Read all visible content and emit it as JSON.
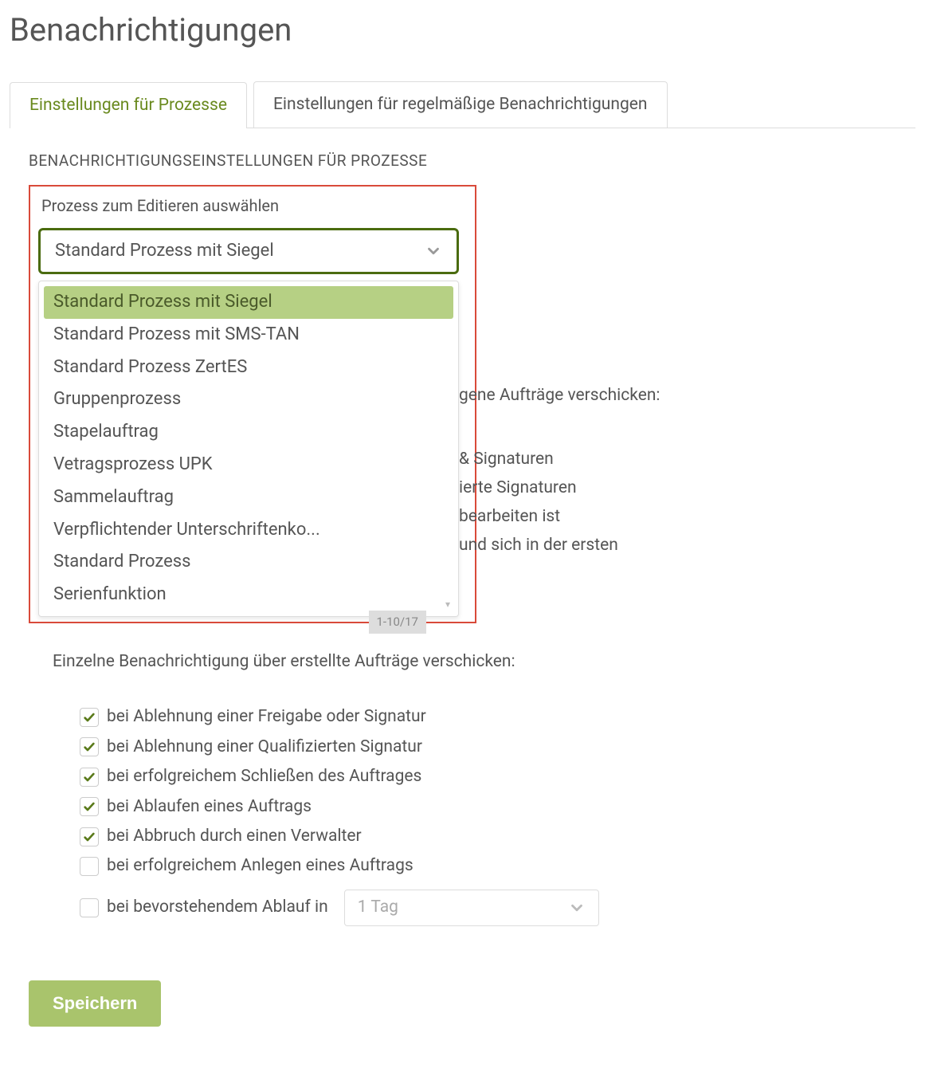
{
  "page_title": "Benachrichtigungen",
  "tabs": [
    {
      "label": "Einstellungen für Prozesse",
      "active": true
    },
    {
      "label": "Einstellungen für regelmäßige Benachrichtigungen",
      "active": false
    }
  ],
  "section_title": "BENACHRICHTIGUNGSEINSTELLUNGEN FÜR PROZESSE",
  "select": {
    "label": "Prozess zum Editieren auswählen",
    "value": "Standard Prozess mit Siegel",
    "options": [
      "Standard Prozess mit Siegel",
      "Standard Prozess mit SMS-TAN",
      "Standard Prozess ZertES",
      "Gruppenprozess",
      "Stapelauftrag",
      "Vetragsprozess UPK",
      "Sammelauftrag",
      "Verpflichtender Unterschriftenko...",
      "Standard Prozess",
      "Serienfunktion"
    ],
    "footer": "1-10/17"
  },
  "behind": {
    "heading_fragment": "gene Aufträge verschicken:",
    "lines": [
      "& Signaturen",
      "ierte Signaturen",
      "bearbeiten ist",
      "und sich in der ersten"
    ]
  },
  "created_heading": "Einzelne Benachrichtigung über erstellte Aufträge verschicken:",
  "checks": [
    {
      "label": "bei Ablehnung einer Freigabe oder Signatur",
      "checked": true
    },
    {
      "label": "bei Ablehnung einer Qualifizierten Signatur",
      "checked": true
    },
    {
      "label": "bei erfolgreichem Schließen des Auftrages",
      "checked": true
    },
    {
      "label": "bei Ablaufen eines Auftrags",
      "checked": true
    },
    {
      "label": "bei Abbruch durch einen Verwalter",
      "checked": true
    },
    {
      "label": "bei erfolgreichem Anlegen eines Auftrags",
      "checked": false
    }
  ],
  "expiry": {
    "label": "bei bevorstehendem Ablauf in",
    "checked": false,
    "value": "1 Tag"
  },
  "save_label": "Speichern",
  "colors": {
    "accent_green": "#6a8a1f",
    "select_border": "#4a6b0f",
    "highlight_red": "#d94a3a",
    "button_green": "#a9c46c",
    "option_selected_bg": "#b6d084"
  }
}
